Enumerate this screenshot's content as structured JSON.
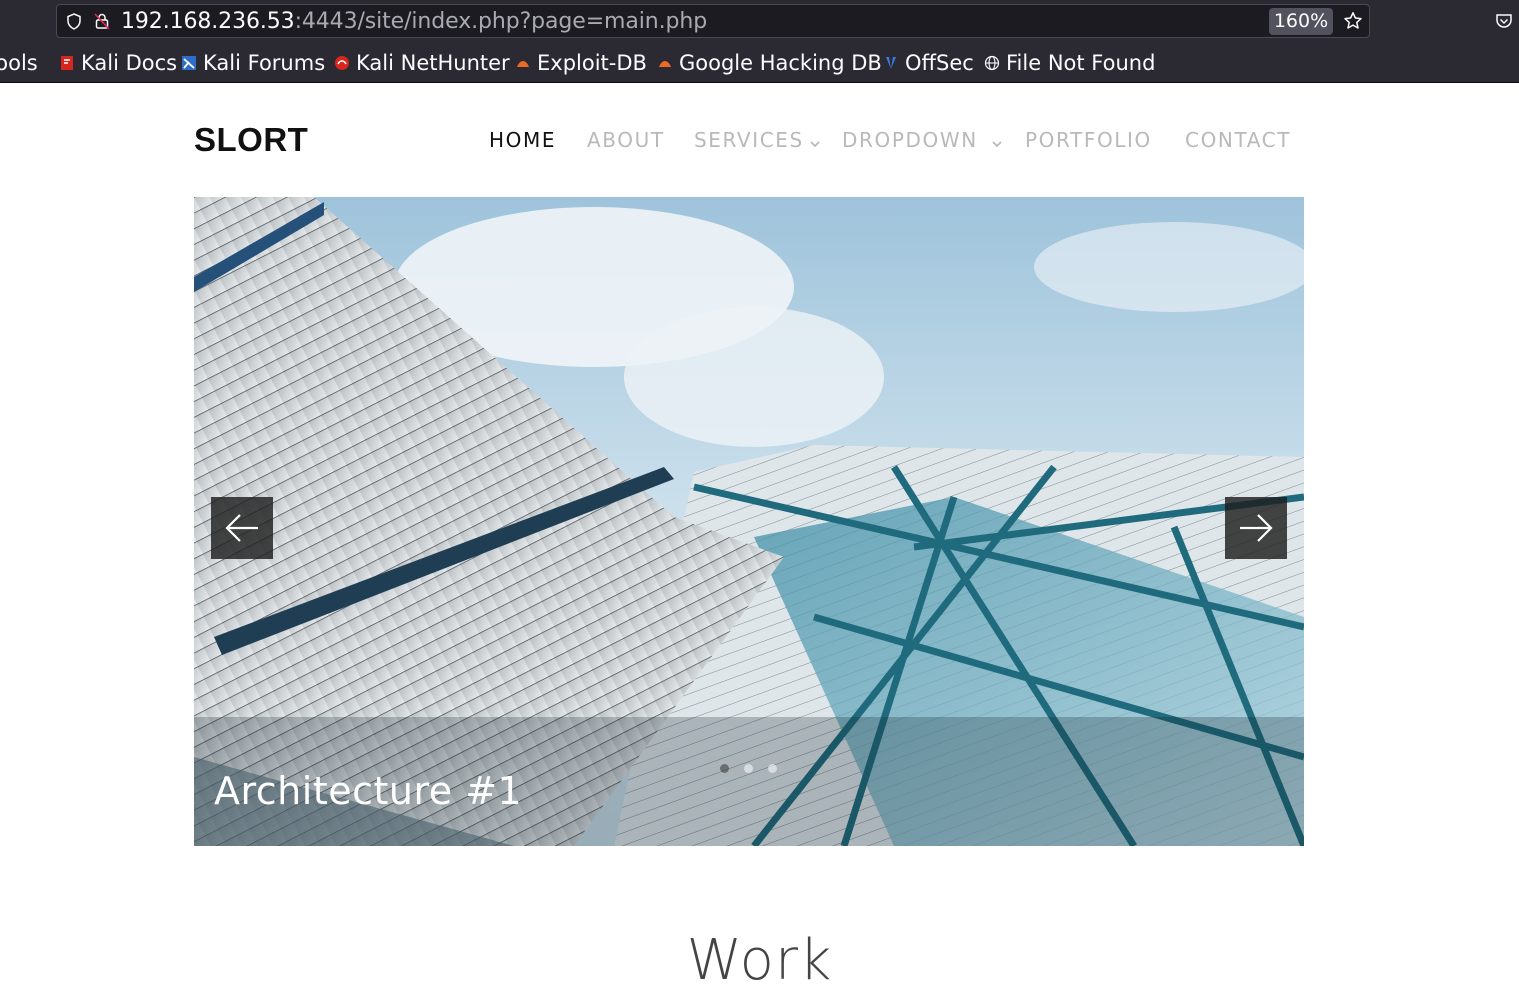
{
  "browser": {
    "url_host": "192.168.236.53",
    "url_rest": ":4443/site/index.php?page=main.php",
    "zoom": "160%",
    "bookmarks": [
      {
        "label": "Tools",
        "icon": "tools-icon"
      },
      {
        "label": "Kali Docs",
        "icon": "kali-docs-icon"
      },
      {
        "label": "Kali Forums",
        "icon": "kali-forums-icon"
      },
      {
        "label": "Kali NetHunter",
        "icon": "kali-nethunter-icon"
      },
      {
        "label": "Exploit-DB",
        "icon": "exploit-db-icon"
      },
      {
        "label": "Google Hacking DB",
        "icon": "google-hacking-db-icon"
      },
      {
        "label": "OffSec",
        "icon": "offsec-icon"
      },
      {
        "label": "File Not Found",
        "icon": "globe-icon"
      }
    ]
  },
  "site": {
    "logo": "SLORT",
    "nav": [
      {
        "label": "HOME",
        "active": true
      },
      {
        "label": "ABOUT"
      },
      {
        "label": "SERVICES",
        "dropdown": true
      },
      {
        "label": "DROPDOWN",
        "dropdown": true
      },
      {
        "label": "PORTFOLIO"
      },
      {
        "label": "CONTACT"
      }
    ],
    "slider": {
      "caption": "Architecture #1",
      "slide_count": 3,
      "active_slide": 1
    },
    "section_title": "Work"
  },
  "colors": {
    "chrome_bg": "#2b2a33",
    "urlbar_bg": "#1c1b22",
    "nav_inactive": "#b9b9b9",
    "nav_active": "#111111"
  }
}
